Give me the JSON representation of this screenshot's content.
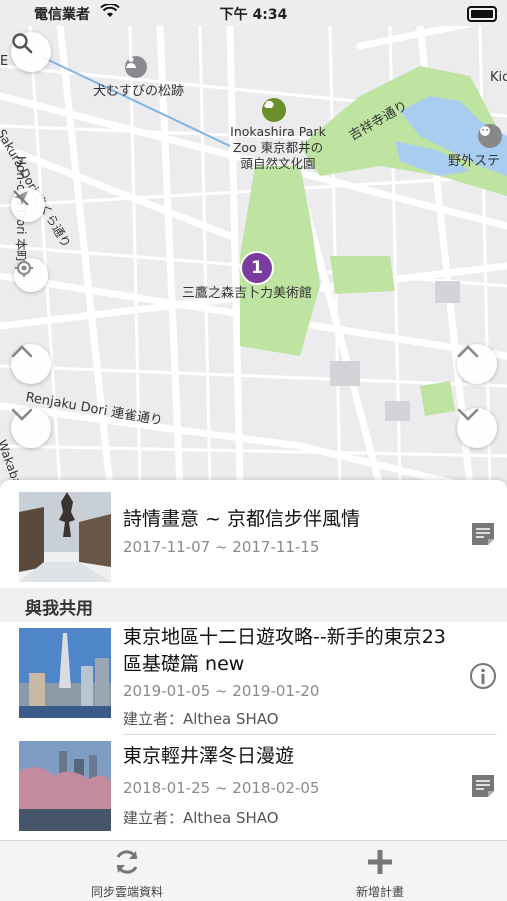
{
  "status_bar": {
    "carrier": "電信業者",
    "time": "下午 4:34"
  },
  "map": {
    "labels": {
      "omusubi": "犬むすびの松跡",
      "kichijoji_dori": "吉祥寺通り",
      "zoo": "Inokashira Park\nZoo 東京都井の\n頭自然文化園",
      "sakura_dori": "Sakura Dori さくら通り",
      "honcho": "Hon-cho Dori 本町",
      "museum": "三鷹之森吉卜力美術館",
      "renjaku": "Renjaku Dori 連雀通り",
      "outdoor_stage": "野外ステ",
      "kichi_edge": "Kic",
      "wakaba": "Wakaba",
      "left_edge": "E"
    },
    "poi_number": "1"
  },
  "plans": {
    "current": {
      "title": "詩情畫意 ~ 京都信步伴風情",
      "dates": "2017-11-07 ~ 2017-11-15"
    },
    "shared_section_label": "與我共用",
    "shared": [
      {
        "title": "東京地區十二日遊攻略--新手的東京23區基礎篇 new",
        "dates": "2019-01-05 ~ 2019-01-20",
        "creator": "建立者：Althea SHAO",
        "icon": "info-icon"
      },
      {
        "title": "東京輕井澤冬日漫遊",
        "dates": "2018-01-25 ~ 2018-02-05",
        "creator": "建立者：Althea SHAO",
        "icon": "note-icon"
      }
    ]
  },
  "tabbar": {
    "sync_label": "同步雲端資料",
    "add_label": "新增計畫"
  },
  "colors": {
    "park_green": "#bfe3a0",
    "poi_purple": "#7a3d9d",
    "water_blue": "#a8cdf0"
  }
}
